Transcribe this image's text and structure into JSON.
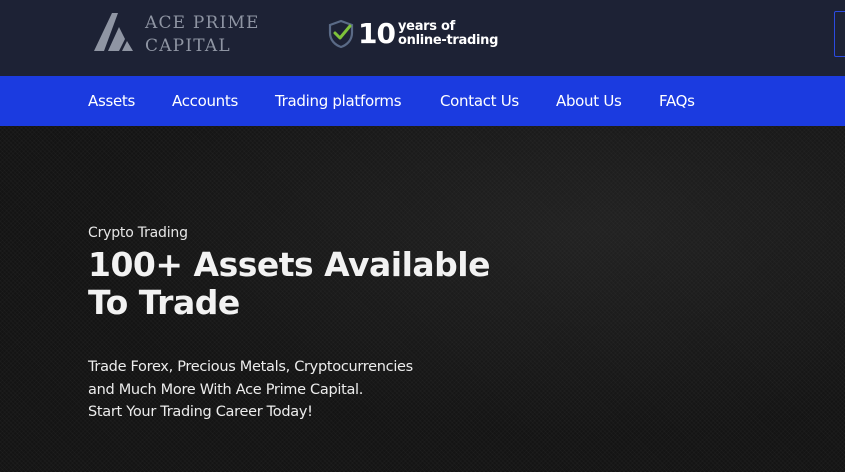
{
  "header": {
    "logo": {
      "line1": "ACE PRIME",
      "line2": "CAPITAL"
    },
    "badge": {
      "number": "10",
      "line1": "years of",
      "line2": "online-trading",
      "icon": "shield-check-icon"
    }
  },
  "nav": {
    "items": [
      {
        "label": "Assets"
      },
      {
        "label": "Accounts"
      },
      {
        "label": "Trading platforms"
      },
      {
        "label": "Contact Us"
      },
      {
        "label": "About Us"
      },
      {
        "label": "FAQs"
      }
    ]
  },
  "hero": {
    "eyebrow": "Crypto Trading",
    "title_line1": "100+ Assets Available",
    "title_line2": "To Trade",
    "desc_line1": "Trade Forex, Precious Metals, Cryptocurrencies",
    "desc_line2": "and Much More With Ace Prime Capital.",
    "desc_line3": "Start Your Trading Career Today!"
  },
  "colors": {
    "header_bg": "#1d2235",
    "nav_bg": "#1b3be0",
    "hero_bg": "#141414",
    "shield_green": "#7ec23a"
  }
}
